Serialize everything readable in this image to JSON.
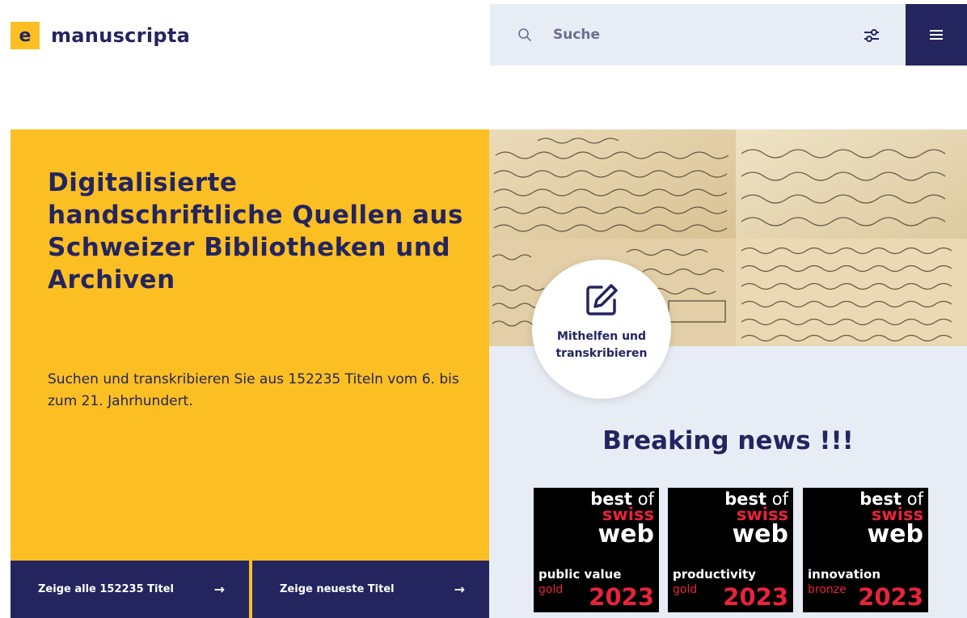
{
  "header": {
    "logo_letter": "e",
    "logo_text": "manuscripta",
    "search_placeholder": "Suche"
  },
  "hero": {
    "title": "Digitalisierte handschriftliche Quellen aus Schweizer Bibliotheken und Archiven",
    "subtitle": "Suchen und transkribieren Sie aus 152235 Titeln vom 6. bis zum 21. Jahrhundert.",
    "buttons": [
      {
        "label": "Zeige alle 152235 Titel",
        "arrow": "→"
      },
      {
        "label": "Zeige neueste Titel",
        "arrow": "→"
      }
    ]
  },
  "help": {
    "label_line1": "Mithelfen und",
    "label_line2": "transkribieren"
  },
  "news": {
    "title": "Breaking news !!!"
  },
  "badges": [
    {
      "best": "best",
      "of": "of",
      "swiss": "swiss",
      "web": "web",
      "category": "public value",
      "medal": "gold",
      "year": "2023"
    },
    {
      "best": "best",
      "of": "of",
      "swiss": "swiss",
      "web": "web",
      "category": "productivity",
      "medal": "gold",
      "year": "2023"
    },
    {
      "best": "best",
      "of": "of",
      "swiss": "swiss",
      "web": "web",
      "category": "innovation",
      "medal": "bronze",
      "year": "2023"
    }
  ],
  "colors": {
    "accent_yellow": "#fbbf24",
    "navy": "#24255f",
    "light_bg": "#e8edf5",
    "badge_red": "#e8233a"
  },
  "icons": [
    "search-icon",
    "filter-icon",
    "menu-icon",
    "arrow-right-icon",
    "edit-icon"
  ]
}
